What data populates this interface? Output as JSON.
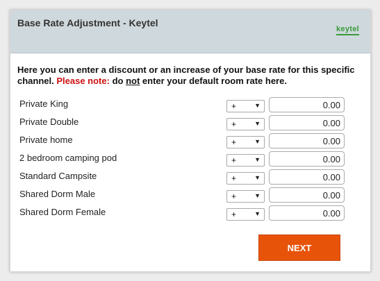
{
  "header": {
    "title": "Base Rate Adjustment - Keytel",
    "logo_text": "keytel"
  },
  "intro": {
    "text": "Here you can enter a discount or an increase of your base rate for this specific channel. ",
    "note_label": "Please note:",
    "text_after_note": " do ",
    "underlined": "not",
    "text_end": " enter your default room rate here."
  },
  "rows": [
    {
      "label": "Private King",
      "operator": "+",
      "value": "0.00"
    },
    {
      "label": "Private Double",
      "operator": "+",
      "value": "0.00"
    },
    {
      "label": "Private home",
      "operator": "+",
      "value": "0.00"
    },
    {
      "label": "2 bedroom camping pod",
      "operator": "+",
      "value": "0.00"
    },
    {
      "label": "Standard Campsite",
      "operator": "+",
      "value": "0.00"
    },
    {
      "label": "Shared Dorm Male",
      "operator": "+",
      "value": "0.00"
    },
    {
      "label": "Shared Dorm Female",
      "operator": "+",
      "value": "0.00"
    }
  ],
  "select_arrow": "▼",
  "next_button": {
    "label": "NEXT"
  },
  "colors": {
    "header_bg": "#cfd9dd",
    "note_red": "#cc1111",
    "button_orange": "#e8530a",
    "logo_green": "#3a9a3a"
  }
}
